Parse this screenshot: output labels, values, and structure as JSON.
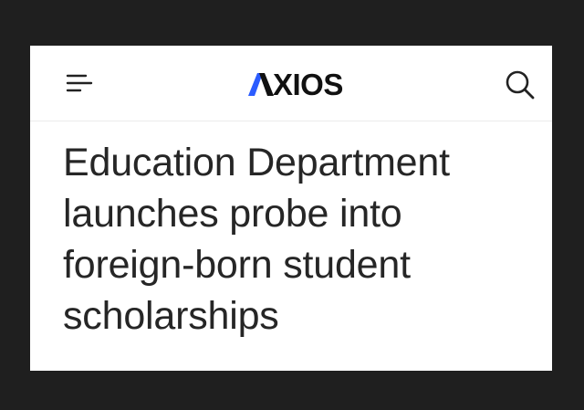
{
  "header": {
    "menu_icon": "hamburger-menu-icon",
    "logo_text": "XIOS",
    "logo_mark_icon": "axios-a-mark-icon",
    "search_icon": "search-icon",
    "accent_blue": "#2b5cff"
  },
  "article": {
    "headline": "Education Department launches probe into foreign-born student scholarships"
  }
}
